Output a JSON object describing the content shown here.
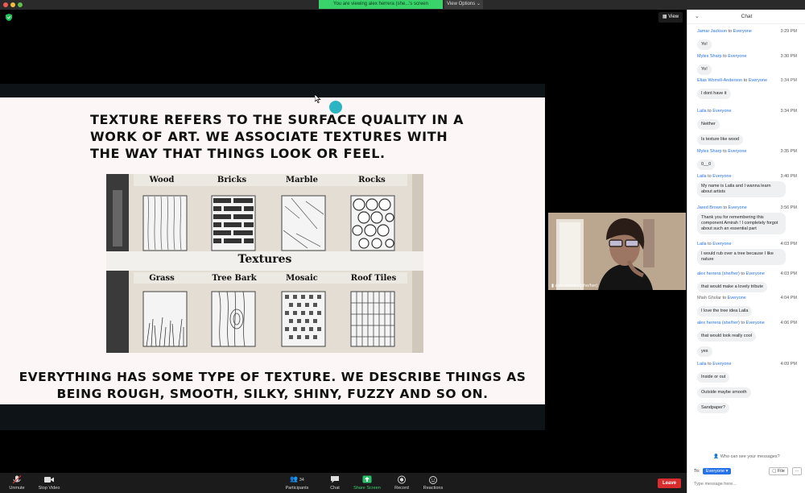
{
  "titlebar": {
    "share_banner": "You are viewing alex herrera (she...'s screen",
    "view_options": "View Options ⌄"
  },
  "meeting": {
    "view_label": "View",
    "slide": {
      "top_text": "TEXTURE REFERS TO THE SURFACE QUALITY IN A WORK OF ART. WE ASSOCIATE TEXTURES WITH THE WAY THAT THINGS LOOK OR FEEL.",
      "bottom_text_line1": "EVERYTHING HAS SOME TYPE OF TEXTURE. WE DESCRIBE THINGS AS",
      "bottom_text_line2": "BEING ROUGH, SMOOTH, SILKY, SHINY, FUZZY AND SO ON.",
      "image": {
        "center_label": "Textures",
        "top_labels": [
          "Wood",
          "Bricks",
          "Marble",
          "Rocks"
        ],
        "bottom_labels": [
          "Grass",
          "Tree Bark",
          "Mosaic",
          "Roof Tiles"
        ]
      }
    },
    "video_name": "alex herrera (she/her)"
  },
  "toolbar": {
    "unmute": "Unmute",
    "stop_video": "Stop Video",
    "participants": "Participants",
    "participants_count": "34",
    "chat": "Chat",
    "share_screen": "Share Screen",
    "record": "Record",
    "reactions": "Reactions",
    "leave": "Leave"
  },
  "chat": {
    "header": "Chat",
    "to_word": "to",
    "messages": [
      {
        "sender": "Jamar Jackson",
        "target": "Everyone",
        "time": "3:29 PM",
        "bubbles": [
          "Yo!"
        ]
      },
      {
        "sender": "Myles Sharp",
        "target": "Everyone",
        "time": "3:30 PM",
        "bubbles": [
          "Yo!"
        ]
      },
      {
        "sender": "Elias Worrell-Anderson",
        "target": "Everyone",
        "time": "3:34 PM",
        "bubbles": [
          "I dont have it"
        ]
      },
      {
        "sender": "Laila",
        "target": "Everyone",
        "time": "3:34 PM",
        "bubbles": [
          "Neither",
          "Is texture like wood"
        ]
      },
      {
        "sender": "Myles Sharp",
        "target": "Everyone",
        "time": "3:35 PM",
        "bubbles": [
          "0__0"
        ]
      },
      {
        "sender": "Laila",
        "target": "Everyone",
        "time": "3:40 PM",
        "bubbles": [
          "My name is Laila and I wanna learn about artists"
        ]
      },
      {
        "sender": "Jared Brown",
        "target": "Everyone",
        "time": "3:56 PM",
        "bubbles": [
          "Thank you for remembering this component Amirah ! I completely forgot about such an essential part"
        ]
      },
      {
        "sender": "Laila",
        "target": "Everyone",
        "time": "4:03 PM",
        "bubbles": [
          "I would rub over a tree because I like nature"
        ]
      },
      {
        "sender": "alex herrera (she/her)",
        "target": "Everyone",
        "time": "4:03 PM",
        "bubbles": [
          "that would make a lovely tribute"
        ]
      },
      {
        "sender": "Miah Gholar",
        "target": "Everyone",
        "time": "4:04 PM",
        "bubbles": [
          "I love the tree idea Laila"
        ]
      },
      {
        "sender": "alex herrera (she/her)",
        "target": "Everyone",
        "time": "4:06 PM",
        "bubbles": [
          "that would look really cool",
          "yes"
        ]
      },
      {
        "sender": "Laila",
        "target": "Everyone",
        "time": "4:09 PM",
        "bubbles": [
          "Inside or out",
          "Outside maybe smooth",
          "Sandpaper?"
        ]
      }
    ],
    "who_can_see": "Who can see your messages?",
    "to_label": "To:",
    "to_value": "Everyone",
    "file_label": "File",
    "more_label": "...",
    "input_placeholder": "Type message here..."
  }
}
